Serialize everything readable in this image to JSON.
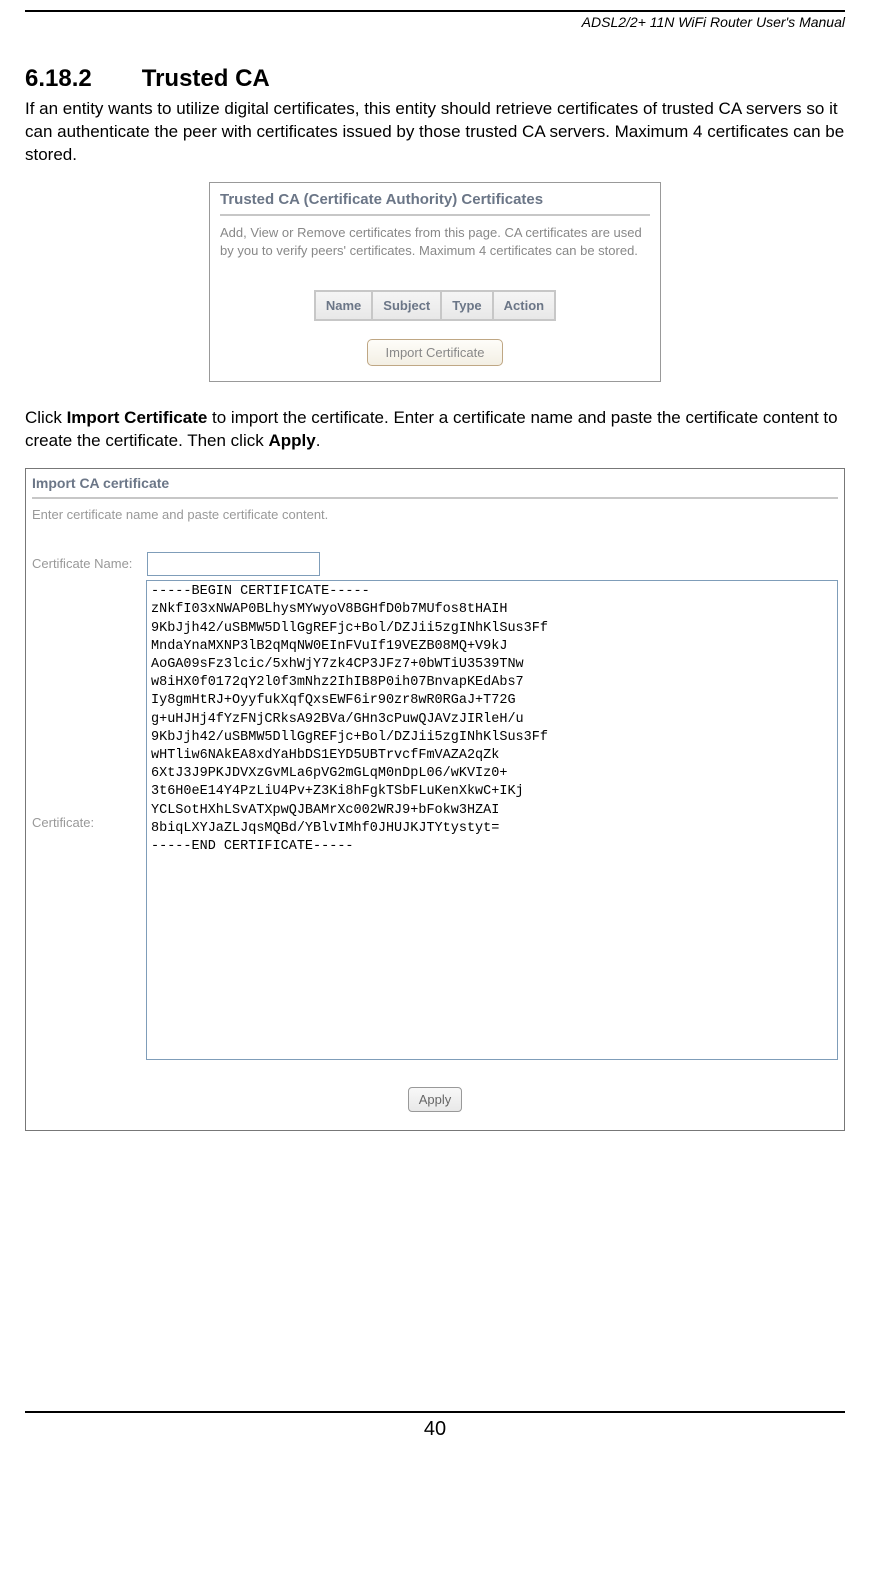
{
  "header": {
    "manual_title": "ADSL2/2+ 11N WiFi Router User's Manual"
  },
  "section": {
    "number": "6.18.2",
    "title": "Trusted CA",
    "paragraph1": "If an entity wants to utilize digital certificates, this entity should retrieve certificates of trusted CA servers so it can authenticate the peer with certificates issued by those trusted CA servers. Maximum 4 certificates can be stored.",
    "paragraph2_pre": "Click ",
    "paragraph2_bold1": "Import Certificate",
    "paragraph2_mid": " to import the certificate. Enter a certificate name and paste the certificate content to create the certificate. Then click ",
    "paragraph2_bold2": "Apply",
    "paragraph2_post": "."
  },
  "panel1": {
    "title": "Trusted CA (Certificate Authority) Certificates",
    "desc": "Add, View or Remove certificates from this page. CA certificates are used by you to verify peers' certificates. Maximum 4 certificates can be stored.",
    "columns": [
      "Name",
      "Subject",
      "Type",
      "Action"
    ],
    "import_button": "Import Certificate"
  },
  "panel2": {
    "title": "Import CA certificate",
    "desc": "Enter certificate name and paste certificate content.",
    "name_label": "Certificate Name:",
    "cert_label": "Certificate:",
    "name_value": "",
    "cert_value": "-----BEGIN CERTIFICATE-----\nzNkfI03xNWAP0BLhysMYwyoV8BGHfD0b7MUfos8tHAIH\n9KbJjh42/uSBMW5DllGgREFjc+Bol/DZJii5zgINhKlSus3Ff\nMndaYnaMXNP3lB2qMqNW0EInFVuIf19VEZB08MQ+V9kJ\nAoGA09sFz3lcic/5xhWjY7zk4CP3JFz7+0bWTiU3539TNw\nw8iHX0f0172qY2l0f3mNhz2IhIB8P0ih07BnvapKEdAbs7\nIy8gmHtRJ+OyyfukXqfQxsEWF6ir90zr8wR0RGaJ+T72G\ng+uHJHj4fYzFNjCRksA92BVa/GHn3cPuwQJAVzJIRleH/u\n9KbJjh42/uSBMW5DllGgREFjc+Bol/DZJii5zgINhKlSus3Ff\nwHTliw6NAkEA8xdYaHbDS1EYD5UBTrvcfFmVAZA2qZk\n6XtJ3J9PKJDVXzGvMLa6pVG2mGLqM0nDpL06/wKVIz0+\n3t6H0eE14Y4PzLiU4Pv+Z3Ki8hFgkTSbFLuKenXkwC+IKj\nYCLSotHXhLSvATXpwQJBAMrXc002WRJ9+bFokw3HZAI\n8biqLXYJaZLJqsMQBd/YBlvIMhf0JHUJKJTYtystyt=\n-----END CERTIFICATE-----",
    "apply_button": "Apply"
  },
  "footer": {
    "page_number": "40"
  }
}
